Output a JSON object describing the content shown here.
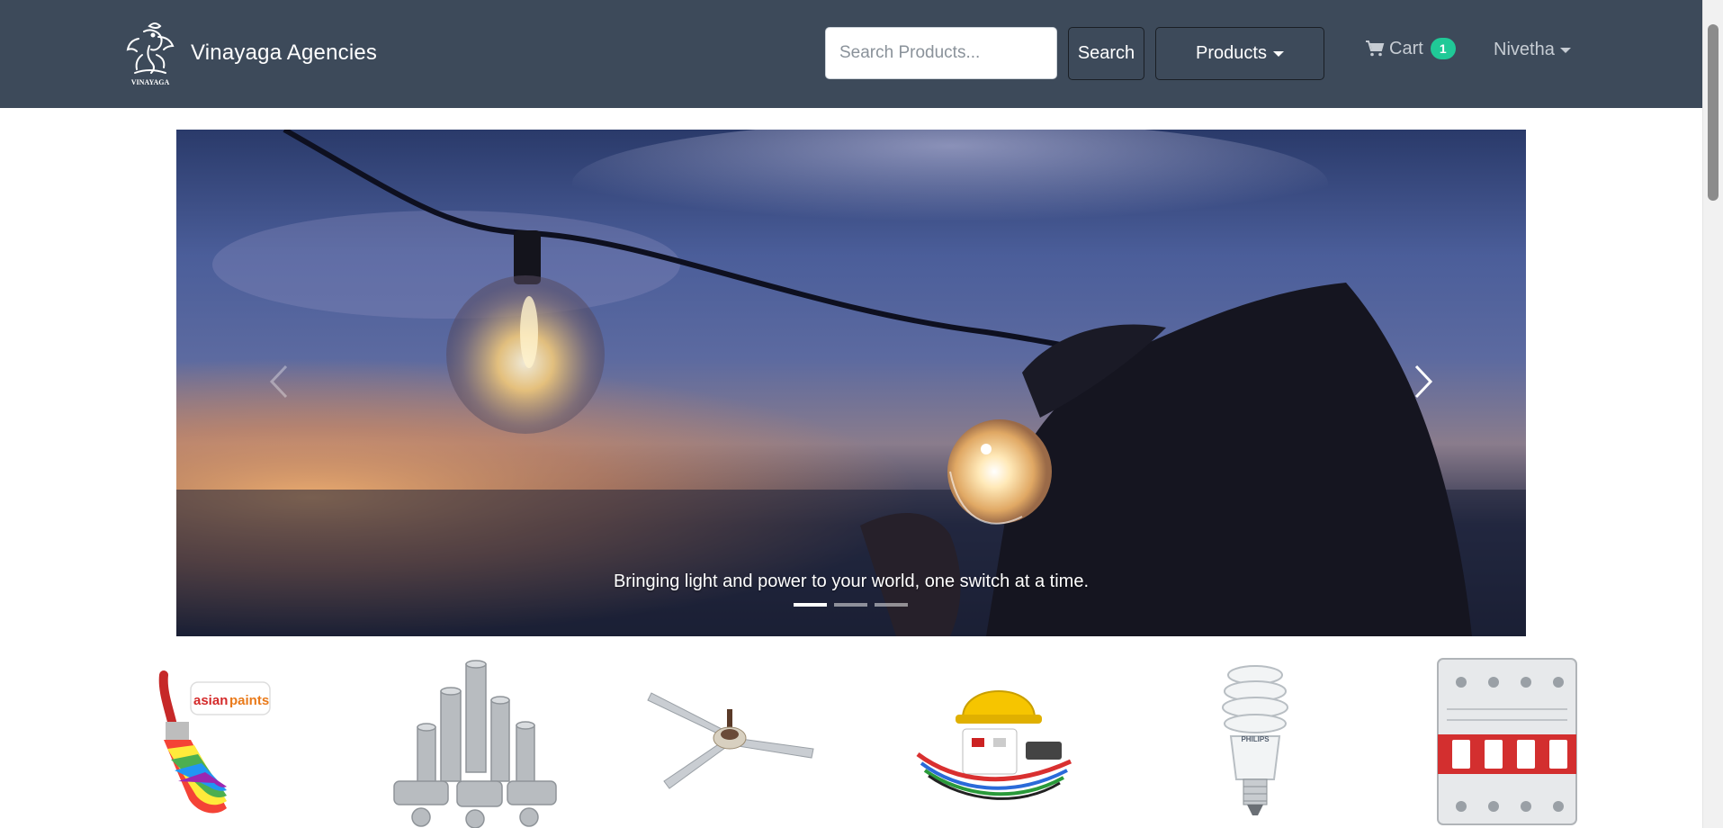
{
  "brand": {
    "name": "Vinayaga Agencies",
    "logo_text": "VINAYAGA"
  },
  "search": {
    "placeholder": "Search Products...",
    "button_label": "Search"
  },
  "nav": {
    "products_label": "Products",
    "cart_label": "Cart",
    "cart_count": "1",
    "user_name": "Nivetha"
  },
  "carousel": {
    "caption": "Bringing light and power to your world, one switch at a time.",
    "slide_count": 3,
    "active_slide": 1
  },
  "categories": [
    {
      "icon": "paint-brush-icon",
      "logo_text_1": "asian",
      "logo_text_2": "paints"
    },
    {
      "icon": "pvc-pipes-icon"
    },
    {
      "icon": "ceiling-fan-icon"
    },
    {
      "icon": "electrical-safety-icon"
    },
    {
      "icon": "cfl-bulb-icon",
      "label": "PHILIPS"
    },
    {
      "icon": "circuit-breaker-icon"
    }
  ],
  "colors": {
    "navbar": "#3d4a5a",
    "badge": "#20c997",
    "muted_text": "#c6ccd3"
  }
}
